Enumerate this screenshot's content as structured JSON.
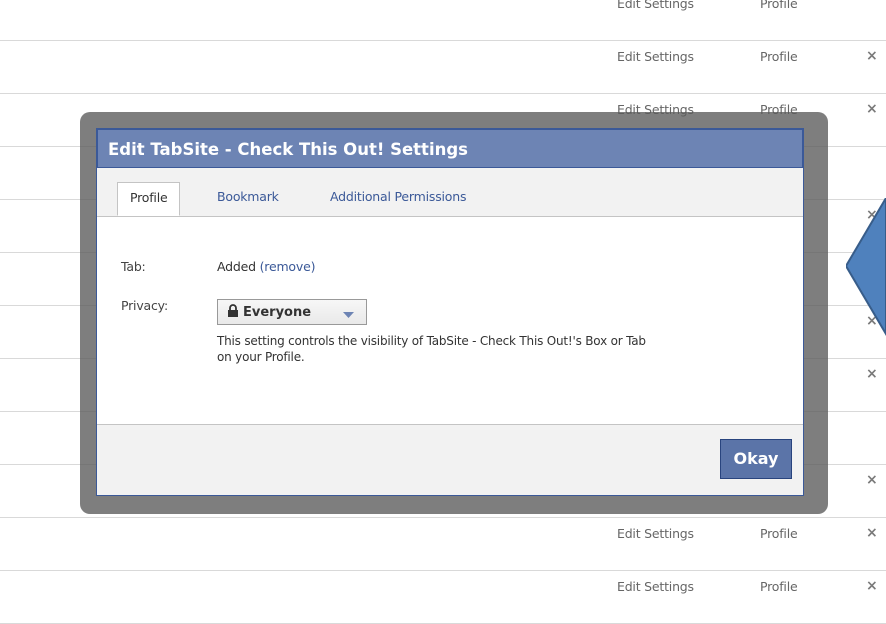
{
  "background_rows": [
    {
      "edit": "Edit Settings",
      "profile": "Profile",
      "close": ""
    },
    {
      "edit": "Edit Settings",
      "profile": "Profile",
      "close": "×"
    },
    {
      "edit": "Edit Settings",
      "profile": "Profile",
      "close": "×"
    },
    {
      "edit": "",
      "profile": "",
      "close": ""
    },
    {
      "edit": "",
      "profile": "",
      "close": "×"
    },
    {
      "edit": "",
      "profile": "",
      "close": ""
    },
    {
      "edit": "",
      "profile": "",
      "close": "×"
    },
    {
      "edit": "",
      "profile": "",
      "close": "×"
    },
    {
      "edit": "",
      "profile": "",
      "close": ""
    },
    {
      "edit": "",
      "profile": "",
      "close": "×"
    },
    {
      "edit": "Edit Settings",
      "profile": "Profile",
      "close": "×"
    },
    {
      "edit": "Edit Settings",
      "profile": "Profile",
      "close": "×"
    }
  ],
  "dialog": {
    "title": "Edit TabSite - Check This Out! Settings",
    "tabs": [
      "Profile",
      "Bookmark",
      "Additional Permissions"
    ],
    "active_tab": "Profile",
    "tab_label": "Tab:",
    "tab_status": "Added",
    "remove_open": "(",
    "remove_link": "remove",
    "remove_close": ")",
    "privacy_label": "Privacy:",
    "privacy_value": "Everyone",
    "help_text": "This setting controls the visibility of TabSite - Check This Out!'s Box or Tab on your Profile.",
    "okay_button": "Okay"
  },
  "icons": {
    "lock": "lock-icon",
    "dropdown": "chevron-down-icon",
    "callout": "callout-arrow"
  },
  "colors": {
    "title_bar": "#6d84b4",
    "link": "#3b5998",
    "okay_button": "#5b74a8",
    "callout_fill": "#4f81bd",
    "callout_stroke": "#385d8a"
  }
}
